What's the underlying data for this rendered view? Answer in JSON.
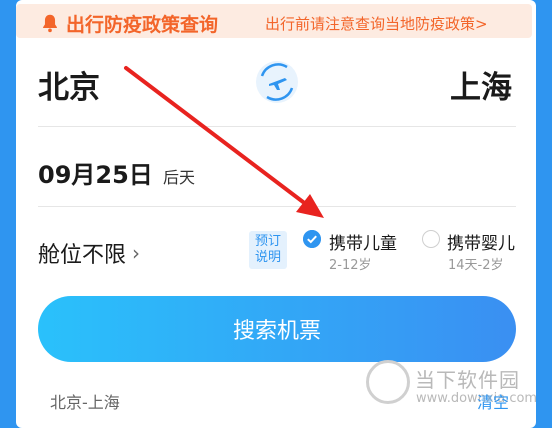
{
  "notice": {
    "icon": "bell-icon",
    "title": "出行防疫政策查询",
    "desc": "出行前请注意查询当地防疫政策>"
  },
  "route": {
    "from": "北京",
    "to": "上海",
    "swap_icon": "plane-swap-icon"
  },
  "date": {
    "value": "09月25日",
    "relative": "后天"
  },
  "cabin": {
    "label": "舱位不限",
    "chevron": "›"
  },
  "booking_note": {
    "line1": "预订",
    "line2": "说明"
  },
  "options": [
    {
      "label": "携带儿童",
      "sub": "2-12岁",
      "checked": true
    },
    {
      "label": "携带婴儿",
      "sub": "14天-2岁",
      "checked": false
    }
  ],
  "search_button": "搜索机票",
  "history": {
    "item": "北京-上海",
    "clear": "清空"
  },
  "watermark": {
    "title": "当下软件园",
    "url": "www.downxia.com"
  },
  "colors": {
    "primary": "#2f95f0",
    "notice": "#f3652a",
    "annotation_arrow": "#e8231f"
  }
}
